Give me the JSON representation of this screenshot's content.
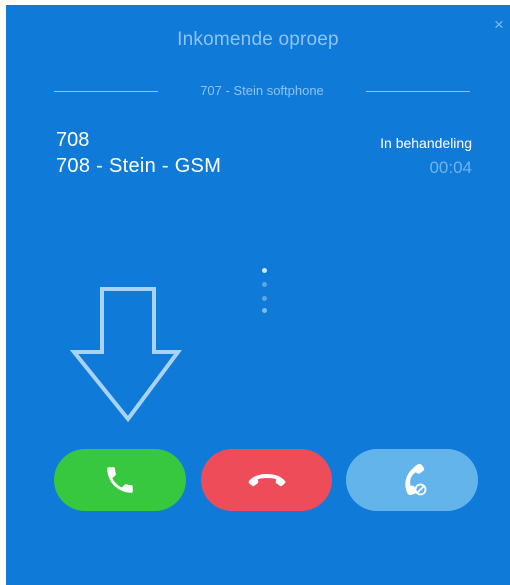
{
  "window": {
    "title": "Inkomende oproep",
    "account": "707 - Stein softphone",
    "close_label": "×"
  },
  "caller": {
    "number": "708",
    "name": "708 - Stein - GSM"
  },
  "call": {
    "status": "In behandeling",
    "duration": "00:04"
  },
  "colors": {
    "background": "#0f7ad8",
    "answer": "#38c83f",
    "decline": "#ef4c5a",
    "reject": "#64b4ec"
  },
  "icons": {
    "answer": "phone-icon",
    "decline": "hang-up-icon",
    "reject": "phone-blocked-icon",
    "pointer": "down-arrow-icon"
  }
}
